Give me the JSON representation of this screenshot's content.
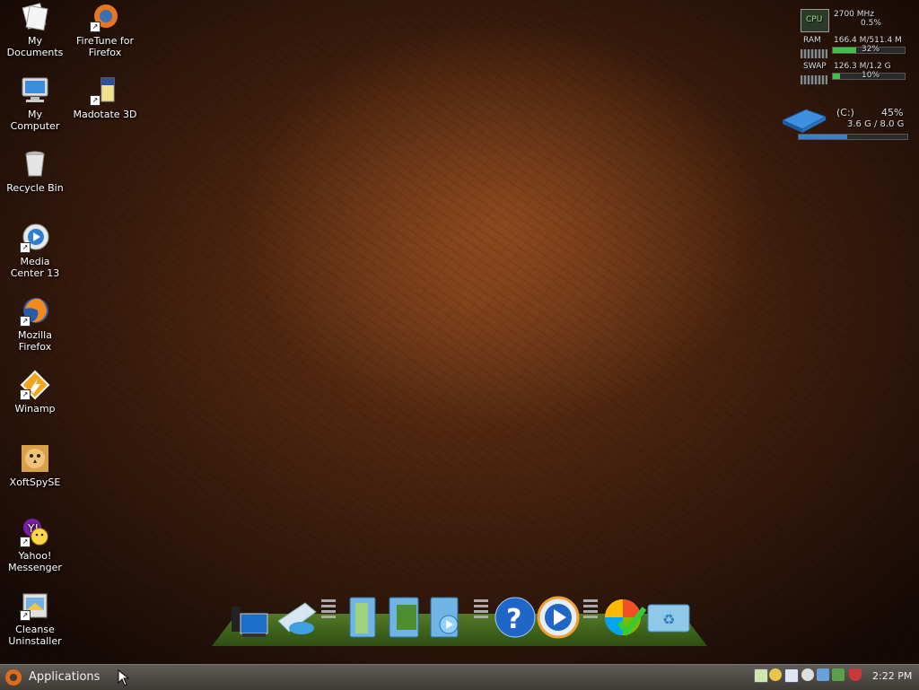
{
  "desktop": {
    "icons": [
      {
        "label": "My\nDocuments",
        "icon": "documents-icon"
      },
      {
        "label": "FireTune for\nFirefox",
        "icon": "firetune-icon"
      },
      {
        "label": "My\nComputer",
        "icon": "computer-icon"
      },
      {
        "label": "Madotate 3D",
        "icon": "madotate-icon"
      },
      {
        "label": "Recycle Bin",
        "icon": "recycle-bin-icon"
      },
      {
        "label": "Media\nCenter 13",
        "icon": "media-center-icon"
      },
      {
        "label": "Mozilla\nFirefox",
        "icon": "firefox-icon"
      },
      {
        "label": "Winamp",
        "icon": "winamp-icon"
      },
      {
        "label": "XoftSpySE",
        "icon": "xoftspy-icon"
      },
      {
        "label": "Yahoo!\nMessenger",
        "icon": "yahoo-messenger-icon"
      },
      {
        "label": "Cleanse\nUninstaller",
        "icon": "cleanse-uninstaller-icon"
      }
    ]
  },
  "monitor": {
    "cpu_label": "CPU",
    "cpu_freq": "2700 MHz",
    "cpu_pct": "0.5%",
    "cpu_value": 0.005,
    "ram_label": "RAM",
    "ram_usage": "166.4 M/511.4 M",
    "ram_pct": "32%",
    "ram_value": 0.32,
    "swap_label": "SWAP",
    "swap_usage": "126.3 M/1.2 G",
    "swap_pct": "10%",
    "swap_value": 0.1,
    "disk_label": "(C:)",
    "disk_pct": "45%",
    "disk_usage": "3.6 G / 8.0 G",
    "disk_value": 0.45
  },
  "dock": {
    "items": [
      "computer-icon",
      "network-icon",
      "documents-folder-icon",
      "pictures-folder-icon",
      "music-folder-icon",
      "help-icon",
      "media-player-icon",
      "windows-update-icon",
      "recycle-folder-icon"
    ]
  },
  "panel": {
    "applications_label": "Applications",
    "clock": "2:22 PM"
  },
  "colors": {
    "accent": "#e06a1a",
    "meter": "#3fc04a",
    "disk_meter": "#3b7fd0"
  }
}
